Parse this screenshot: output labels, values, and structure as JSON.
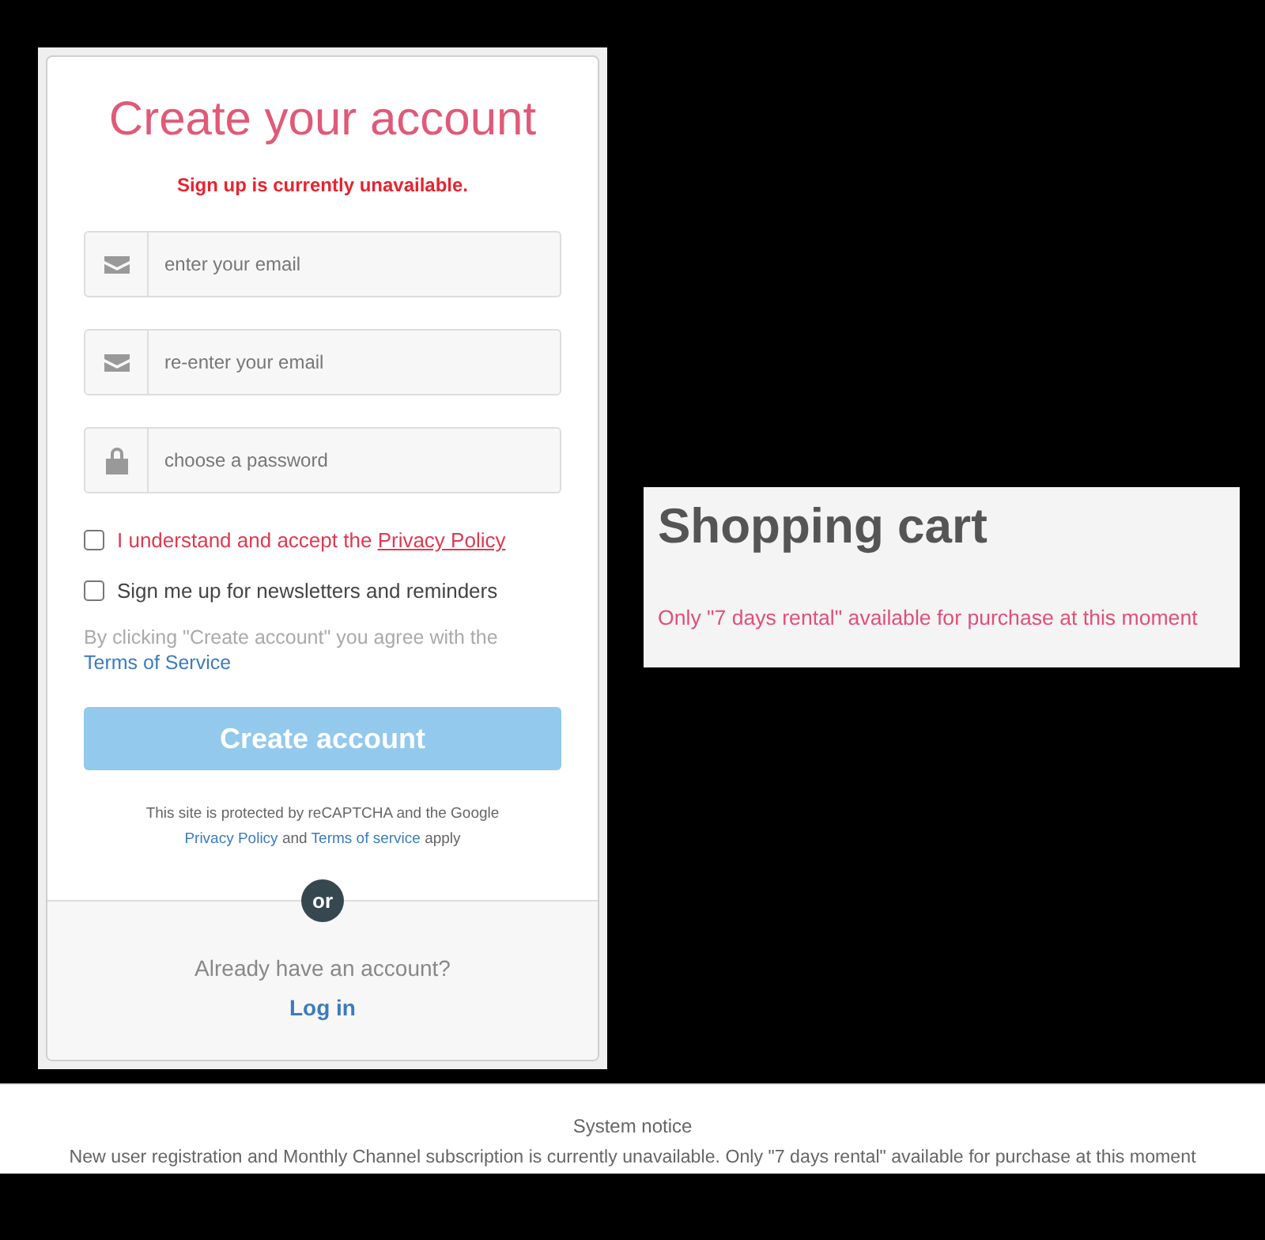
{
  "signup": {
    "title": "Create your account",
    "error": "Sign up is currently unavailable.",
    "fields": [
      {
        "kind": "email",
        "placeholder": "enter your email"
      },
      {
        "kind": "email",
        "placeholder": "re-enter your email"
      },
      {
        "kind": "password",
        "placeholder": "choose a password"
      }
    ],
    "checkboxes": [
      {
        "label": "I understand and accept the",
        "link": "Privacy Policy",
        "checked": false,
        "invalid": true
      },
      {
        "label": "Sign me up for newsletters and reminders",
        "checked": false,
        "invalid": false
      }
    ],
    "terms": {
      "text": "By clicking \"Create account\" you agree with the",
      "link": "Terms of Service"
    },
    "submit": {
      "label": "Create account",
      "disabled": true
    },
    "recaptcha": {
      "line": "This site is protected by reCAPTCHA and the Google",
      "parts": [
        {
          "kind": "link",
          "text": "Privacy Policy"
        },
        {
          "kind": "text",
          "text": "and"
        },
        {
          "kind": "link",
          "text": "Terms of service"
        },
        {
          "kind": "text",
          "text": "apply"
        }
      ]
    },
    "divider": "or",
    "login": {
      "prompt": "Already have an account?",
      "link": "Log in"
    }
  },
  "cart": {
    "title": "Shopping cart",
    "message": "Only \"7 days rental\" available for purchase at this moment"
  },
  "notice": {
    "title": "System notice",
    "message": "New user registration and Monthly Channel subscription is currently unavailable. Only \"7 days rental\" available for purchase at this moment"
  }
}
